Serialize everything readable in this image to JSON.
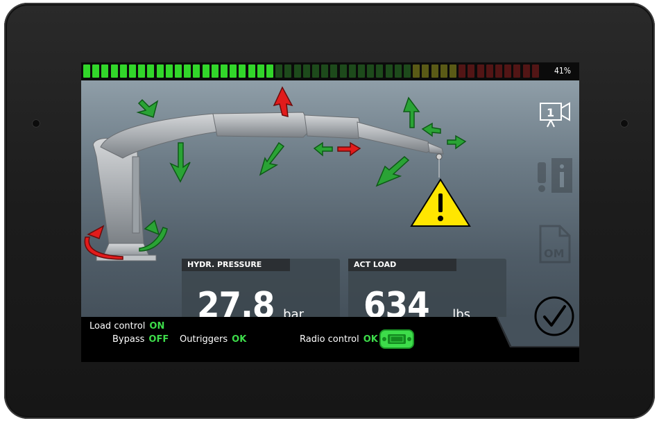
{
  "top_bar": {
    "load_percent": "41%",
    "load_fraction": 0.41
  },
  "side_icons": [
    "camera-1-icon",
    "info-warning-icon",
    "operator-manual-icon",
    "confirm-check-icon"
  ],
  "camera_number": "1",
  "manual_label": "OM",
  "panels": {
    "pressure": {
      "title": "HYDR. PRESSURE",
      "value": "27.8",
      "unit": "bar"
    },
    "load": {
      "title": "ACT LOAD",
      "value": "634",
      "unit": "lbs"
    }
  },
  "status": {
    "load_control": {
      "label": "Load control",
      "value": "ON"
    },
    "bypass": {
      "label": "Bypass",
      "value": "OFF"
    },
    "outriggers": {
      "label": "Outriggers",
      "value": "OK"
    },
    "radio_control": {
      "label": "Radio control",
      "value": "OK"
    }
  },
  "colors": {
    "ok_green": "#3ddc4a",
    "arrow_green": "#2aa335",
    "arrow_red": "#e21b1b",
    "warning_yellow": "#ffe600"
  }
}
